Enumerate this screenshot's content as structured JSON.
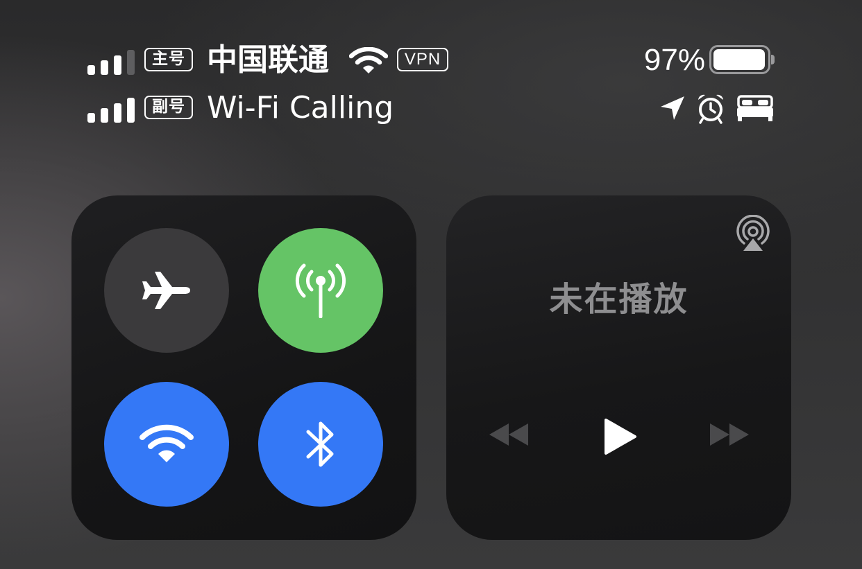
{
  "status_bar": {
    "primary_line": {
      "badge": "主号",
      "carrier": "中国联通",
      "vpn_label": "VPN",
      "signal_bars_filled": 3,
      "signal_bars_total": 4
    },
    "secondary_line": {
      "badge": "副号",
      "carrier": "Wi-Fi Calling",
      "signal_bars_filled": 4,
      "signal_bars_total": 4
    },
    "battery_percent_text": "97%",
    "battery_level": 0.97,
    "icons": [
      "location-arrow-icon",
      "alarm-clock-icon",
      "sleep-bed-icon"
    ]
  },
  "connectivity": {
    "toggles": [
      {
        "name": "airplane-mode",
        "icon": "airplane-icon",
        "state": "off",
        "color": "#3b3a3c"
      },
      {
        "name": "cellular-data",
        "icon": "antenna-icon",
        "state": "on",
        "color": "#65c466"
      },
      {
        "name": "wifi",
        "icon": "wifi-icon",
        "state": "on",
        "color": "#3478f6"
      },
      {
        "name": "bluetooth",
        "icon": "bluetooth-icon",
        "state": "on",
        "color": "#3478f6"
      }
    ]
  },
  "now_playing": {
    "title": "未在播放",
    "controls": [
      "rewind-icon",
      "play-icon",
      "fast-forward-icon"
    ],
    "airplay_icon": "airplay-audio-icon"
  }
}
